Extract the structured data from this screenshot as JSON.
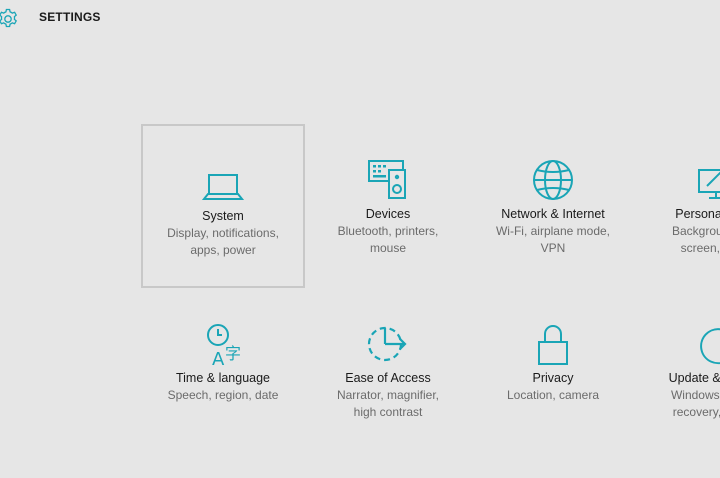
{
  "header": {
    "title": "SETTINGS"
  },
  "accent_color": "#1aa5b6",
  "tiles": [
    {
      "name": "System",
      "desc": [
        "Display, notifications,",
        "apps, power"
      ],
      "icon": "laptop-icon",
      "selected": true
    },
    {
      "name": "Devices",
      "desc": [
        "Bluetooth, printers,",
        "mouse"
      ],
      "icon": "keyboard-speaker-icon"
    },
    {
      "name": "Network & Internet",
      "desc": [
        "Wi-Fi, airplane mode,",
        "VPN"
      ],
      "icon": "globe-icon"
    },
    {
      "name": "Personalization",
      "desc": [
        "Background, lock",
        "screen, colors"
      ],
      "icon": "brush-monitor-icon"
    },
    {
      "name": "Time & language",
      "desc": [
        "Speech, region, date"
      ],
      "icon": "time-language-icon"
    },
    {
      "name": "Ease of Access",
      "desc": [
        "Narrator, magnifier,",
        "high contrast"
      ],
      "icon": "ease-of-access-icon"
    },
    {
      "name": "Privacy",
      "desc": [
        "Location, camera"
      ],
      "icon": "lock-icon"
    },
    {
      "name": "Update & security",
      "desc": [
        "Windows Update,",
        "recovery, backup"
      ],
      "icon": "refresh-icon"
    }
  ]
}
